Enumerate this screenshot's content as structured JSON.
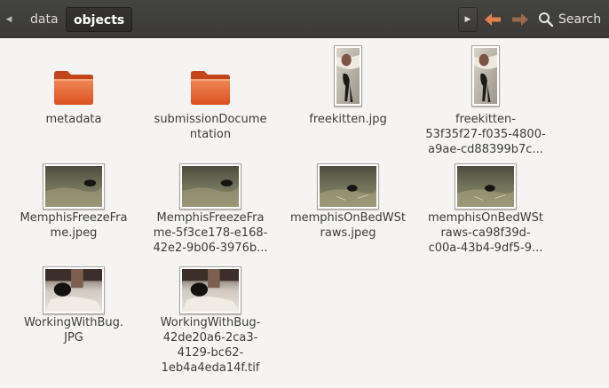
{
  "header": {
    "breadcrumbs": [
      {
        "label": "data",
        "active": false
      },
      {
        "label": "objects",
        "active": true
      }
    ],
    "search_label": "Search"
  },
  "colors": {
    "header_bg": "#3c3b37",
    "folder_orange": "#e25c2a",
    "nav_arrow_orange": "#e3804a",
    "window_bg": "#f5f4f2"
  },
  "files": [
    {
      "name_lines": [
        "metadata"
      ],
      "kind": "folder"
    },
    {
      "name_lines": [
        "submissionDocume",
        "ntation"
      ],
      "kind": "folder"
    },
    {
      "name_lines": [
        "freekitten.jpg"
      ],
      "kind": "image-portrait"
    },
    {
      "name_lines": [
        "freekitten-",
        "53f35f27-f035-4800-",
        "a9ae-cd88399b7c..."
      ],
      "kind": "image-portrait"
    },
    {
      "name_lines": [
        "MemphisFreezeFra",
        "me.jpeg"
      ],
      "kind": "image-bed"
    },
    {
      "name_lines": [
        "MemphisFreezeFra",
        "me-5f3ce178-e168-",
        "42e2-9b06-3976b..."
      ],
      "kind": "image-bed"
    },
    {
      "name_lines": [
        "memphisOnBedWSt",
        "raws.jpeg"
      ],
      "kind": "image-bed"
    },
    {
      "name_lines": [
        "memphisOnBedWSt",
        "raws-ca98f39d-",
        "c00a-43b4-9df5-9..."
      ],
      "kind": "image-bed"
    },
    {
      "name_lines": [
        "WorkingWithBug.",
        "JPG"
      ],
      "kind": "image-bug"
    },
    {
      "name_lines": [
        "WorkingWithBug-",
        "42de20a6-2ca3-",
        "4129-bc62-",
        "1eb4a4eda14f.tif"
      ],
      "kind": "image-bug"
    }
  ]
}
